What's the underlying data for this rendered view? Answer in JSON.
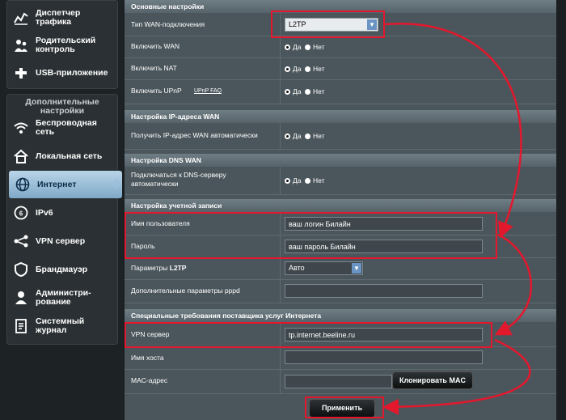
{
  "sidebar": {
    "top_items": [
      {
        "label": "Диспетчер трафика",
        "icon": "traffic-manager-icon"
      },
      {
        "label": "Родительский контроль",
        "icon": "parental-control-icon"
      },
      {
        "label": "USB-приложение",
        "icon": "usb-application-icon"
      }
    ],
    "group_header": "Дополнительные настройки",
    "items": [
      {
        "label": "Беспроводная сеть",
        "icon": "wireless-icon"
      },
      {
        "label": "Локальная сеть",
        "icon": "home-icon"
      },
      {
        "label": "Интернет",
        "icon": "globe-icon"
      },
      {
        "label": "IPv6",
        "icon": "ipv6-icon"
      },
      {
        "label": "VPN сервер",
        "icon": "vpn-icon"
      },
      {
        "label": "Брандмауэр",
        "icon": "firewall-icon"
      },
      {
        "label": "Администри-рование",
        "icon": "administration-icon"
      },
      {
        "label": "Системный журнал",
        "icon": "system-log-icon"
      }
    ]
  },
  "sections": {
    "basic": {
      "title": "Основные настройки",
      "wan_type_label": "Тип WAN-подключения",
      "wan_type_value": "L2TP",
      "enable_wan_label": "Включить WAN",
      "enable_nat_label": "Включить NAT",
      "enable_upnp_label": "Включить UPnP",
      "upnp_faq": "UPnP  FAQ"
    },
    "wan_ip": {
      "title": "Настройка IP-адреса WAN",
      "auto_ip_label": "Получить IP-адрес WAN автоматически"
    },
    "wan_dns": {
      "title": "Настройка DNS WAN",
      "auto_dns_label": "Подключаться к DNS-серверу автоматически"
    },
    "account": {
      "title": "Настройка учетной записи",
      "username_label": "Имя пользователя",
      "username_value": "ваш логин Билайн",
      "password_label": "Пароль",
      "password_value": "ваш пароль Билайн",
      "l2tp_params_label": "Параметры",
      "l2tp_params_suffix": "L2TP",
      "l2tp_params_value": "Авто",
      "pppd_label": "Дополнительные параметры pppd",
      "pppd_value": ""
    },
    "isp": {
      "title": "Специальные требования поставщика услуг Интернета",
      "vpn_label": "VPN сервер",
      "vpn_value": "tp.internet.beeline.ru",
      "host_label": "Имя хоста",
      "host_value": "",
      "mac_label": "MAC-адрес",
      "mac_value": "",
      "clone_mac": "Клонировать MAC"
    }
  },
  "radio": {
    "yes": "Да",
    "no": "Нет"
  },
  "apply_button": "Применить",
  "colors": {
    "annotation": "#e3182d",
    "active_item": "#9cc0db",
    "select_arrow": "#6a94c4"
  }
}
